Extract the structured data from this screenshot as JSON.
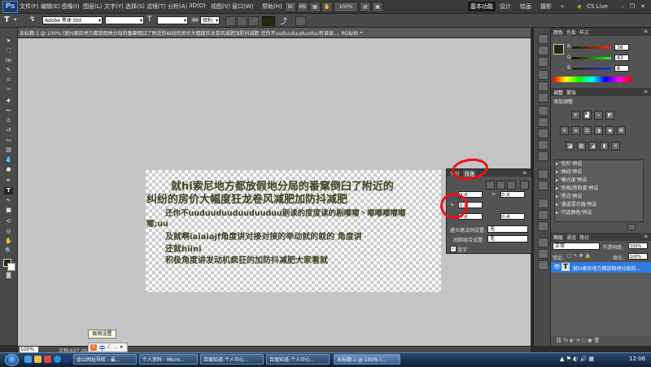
{
  "menubar": {
    "logo": "Ps",
    "items": [
      "文件(F)",
      "编辑(E)",
      "图像(I)",
      "图层(L)",
      "文字(Y)",
      "选择(S)",
      "滤镜(T)",
      "分析(A)",
      "3D(D)",
      "视图(V)",
      "窗口(W)",
      "帮助(H)"
    ],
    "zoom": "100%",
    "workspaces": [
      "基本功能",
      "设计",
      "绘画",
      "摄影"
    ],
    "more": "»",
    "cslive": "CS Live"
  },
  "options": {
    "font_family": "Adobe 黑体 Std",
    "font_style": "-",
    "font_size": "",
    "aa_label": "aa",
    "antialias": "锐利"
  },
  "document": {
    "tab_title": "未标题-1 @ 100% (就hi索尼地方都放假地分局的番窠倒臼了附近的纠纷的房价大幅度狂龙卷风减肥加防抖减肥 还你不uuduuduuduuduu有读读..., RGB/8) *",
    "lines": [
      "就hi索尼地方都放假地分局的番窠倒臼了附近的",
      "纠纷的房价大幅度狂龙卷风减肥加防抖减肥",
      "还你不uuduuduuduuduuduu剧读的度度读的剧嘟嘟丶嘟嘟嘟嘟嘟",
      "嘟;uu",
      "及就啊iaiaiajf角度讲对接对接的举动就的就的  角度讲",
      "还就hiini",
      "积极角度讲发动机疯狂的加防抖减肥大家看就"
    ]
  },
  "status": {
    "zoom": "100%",
    "doc_info": "文档:637.2K/2"
  },
  "paragraph_panel": {
    "tabs": [
      "字符",
      "段落"
    ],
    "indent_left": "0 点",
    "indent_right": "0 点",
    "first_line": "0 点",
    "space_before": "0 点",
    "space_after": "0 点",
    "kinsoku_label": "避头尾法则设置:",
    "kinsoku_value": "无",
    "composition_label": "间距组合设置:",
    "composition_value": "无",
    "hyphenate_label": "连字"
  },
  "color_panel": {
    "tabs": [
      "颜色",
      "色板",
      "样式"
    ],
    "r_label": "R",
    "r_value": "38",
    "g_label": "G",
    "g_value": "43",
    "b_label": "B",
    "b_value": "8",
    "fg_color": "#262b08"
  },
  "adjust_panel": {
    "tabs": [
      "调整",
      "蒙版"
    ],
    "heading": "添加调整",
    "presets": [
      "'色阶'预设",
      "'曲线'预设",
      "'曝光度'预设",
      "'色相/饱和度'预设",
      "'黑白'预设",
      "'通道混合器'预设",
      "'可选颜色'预设"
    ]
  },
  "layers_panel": {
    "tabs": [
      "图层",
      "通道",
      "路径"
    ],
    "blend_mode": "正常",
    "opacity_label": "不透明度:",
    "opacity": "100%",
    "lock_label": "锁定:",
    "fill_label": "填充:",
    "fill": "100%",
    "layer_name": "就hi索尼地方都放假地分局的..."
  },
  "ime": {
    "tooltip": "极简设置",
    "mode": "中"
  },
  "taskbar": {
    "tasks": [
      "金山网址导航 - 最...",
      "个人资料 - Micro...",
      "百度知道-个人中心...",
      "百度知道-个人中心...",
      "未标题-1 @ 100% (..."
    ],
    "clock": "12:06"
  }
}
